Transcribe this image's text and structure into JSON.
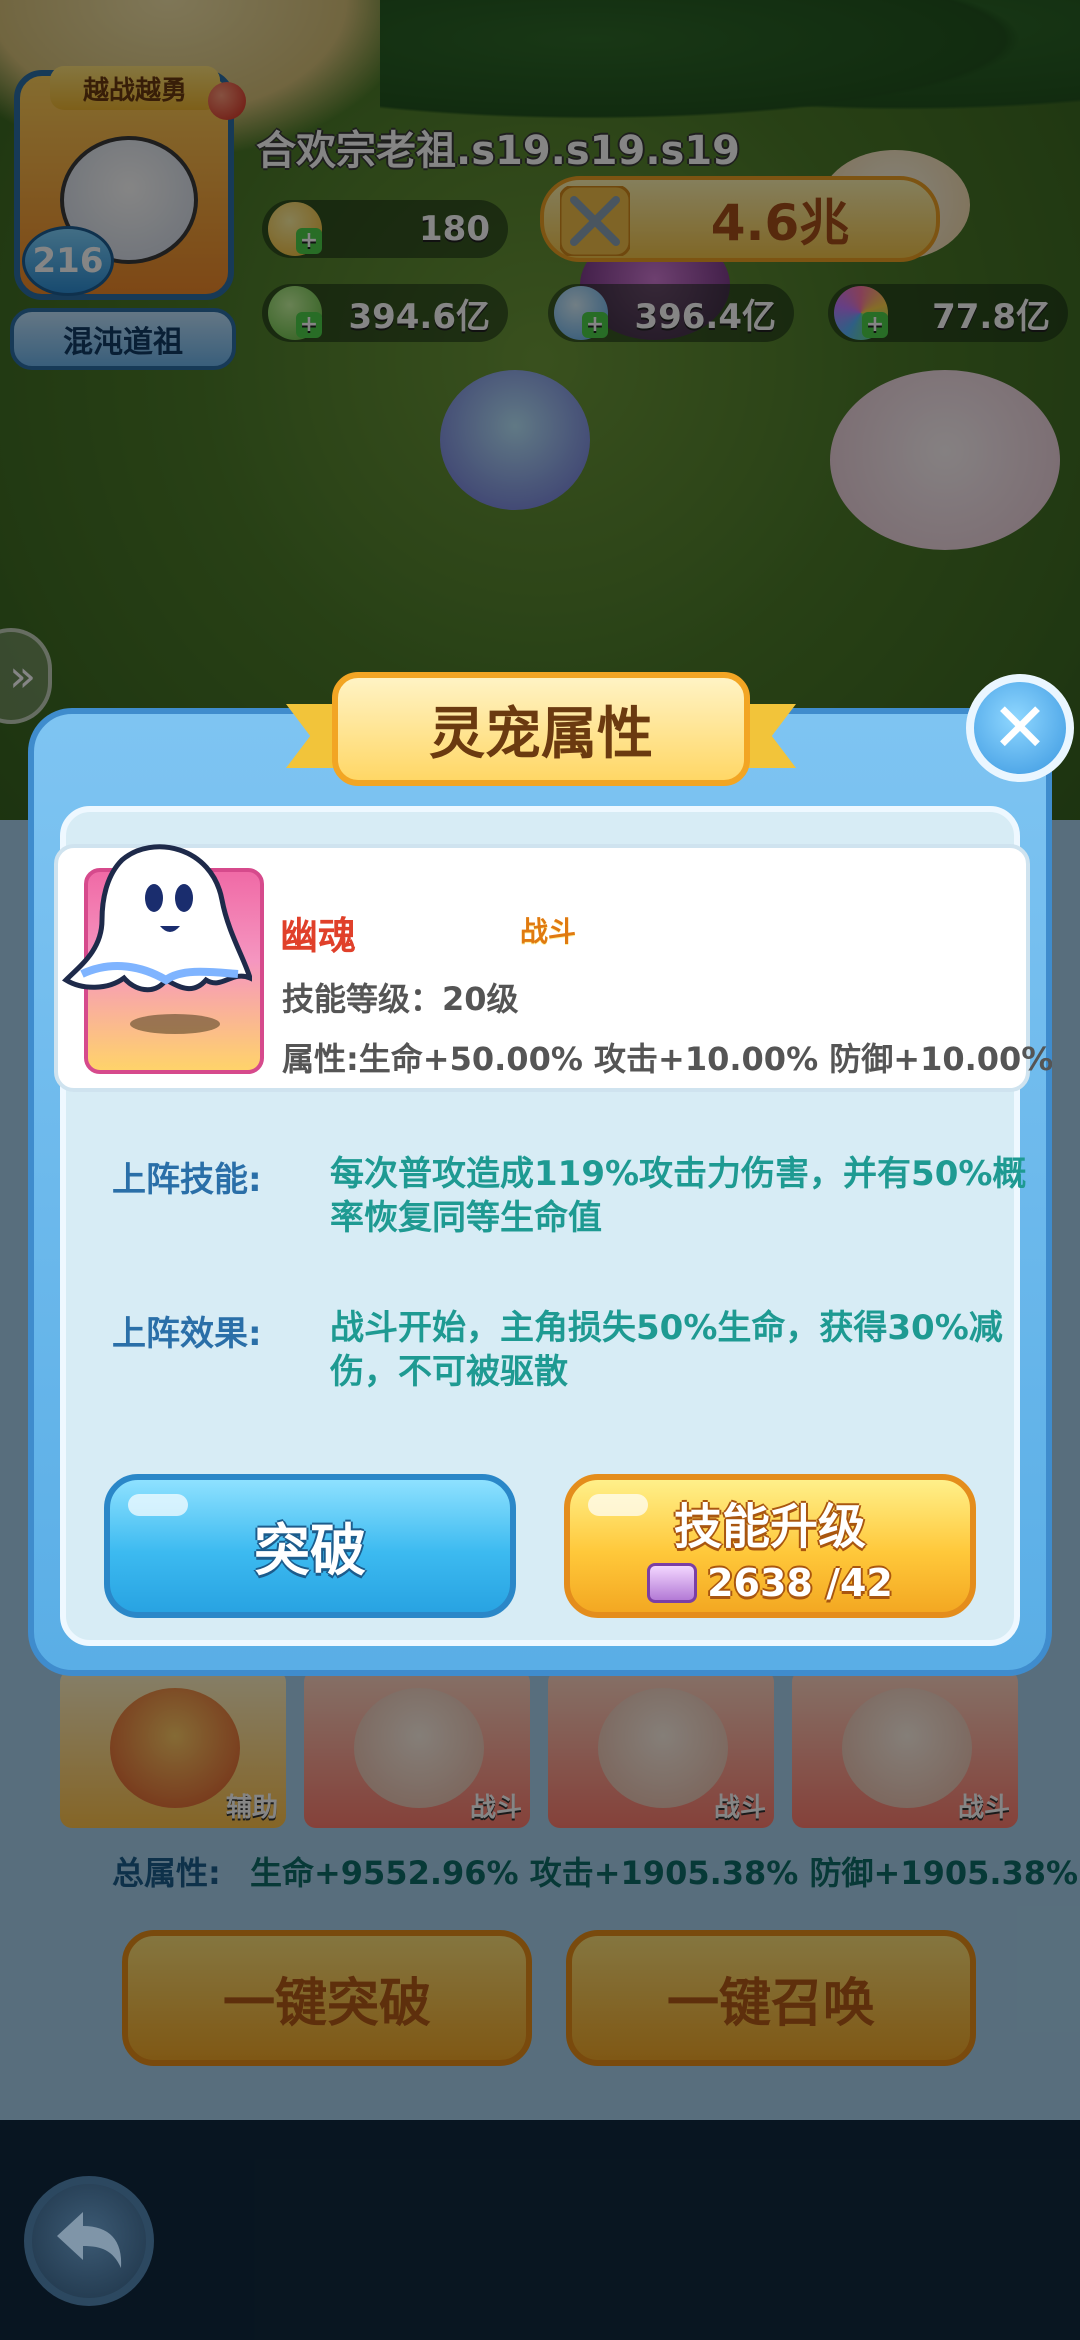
{
  "player": {
    "badge": "越战越勇",
    "level": "216",
    "rank": "混沌道祖",
    "name": "合欢宗老祖.s19.s19.s19"
  },
  "currencies": [
    {
      "icon": "gold-egg-icon",
      "value": "180"
    },
    {
      "icon": "green-egg-icon",
      "value": "394.6亿"
    },
    {
      "icon": "blue-egg-icon",
      "value": "396.4亿"
    },
    {
      "icon": "rainbow-egg-icon",
      "value": "77.8亿"
    }
  ],
  "power": "4.6兆",
  "modal": {
    "title": "灵宠属性",
    "pet": {
      "name": "幽魂",
      "type": "战斗",
      "level": "技能等级：20级",
      "attributes": "属性:生命+50.00% 攻击+10.00% 防御+10.00%"
    },
    "skills": [
      {
        "label": "上阵技能:",
        "text": "每次普攻造成119%攻击力伤害，并有50%概率恢复同等生命值"
      },
      {
        "label": "上阵效果:",
        "text": "战斗开始，主角损失50%生命，获得30%减伤，不可被驱散"
      }
    ],
    "breakthrough_label": "突破",
    "upgrade_label": "技能升级",
    "upgrade_cost": "2638 /42"
  },
  "background_panel": {
    "cards": [
      {
        "tag": "辅助"
      },
      {
        "tag": "战斗"
      },
      {
        "tag": "战斗"
      },
      {
        "tag": "战斗"
      }
    ],
    "total_label": "总属性:",
    "total_value": "生命+9552.96% 攻击+1905.38% 防御+1905.38%",
    "one_click_break": "一键突破",
    "one_click_summon": "一键召唤"
  },
  "colors": {
    "modal_blue": "#5aaee6",
    "gold_button": "#ffc83a",
    "blue_button": "#3cbaf0",
    "pet_name": "#e0402a",
    "skill_text": "#1e9a92"
  }
}
